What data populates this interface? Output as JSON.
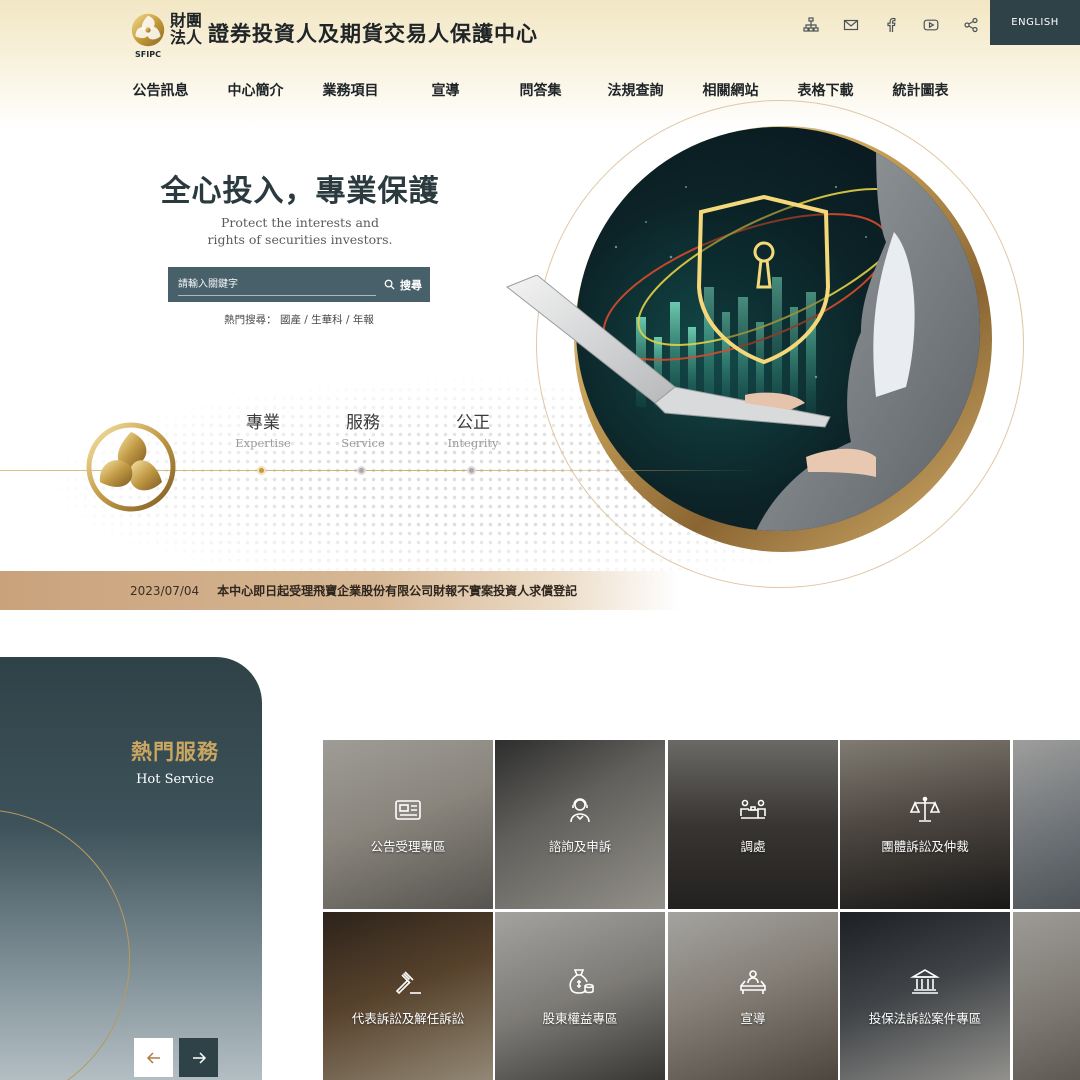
{
  "header": {
    "org_prefix": [
      "財團",
      "法人"
    ],
    "org_name": "證券投資人及期貨交易人保護中心",
    "org_abbr": "SFIPC",
    "utility_icons": [
      "sitemap-icon",
      "mail-icon",
      "facebook-icon",
      "youtube-icon",
      "share-icon"
    ],
    "language_button": "ENGLISH"
  },
  "nav": {
    "items": [
      "公告訊息",
      "中心簡介",
      "業務項目",
      "宣導",
      "問答集",
      "法規查詢",
      "相關網站",
      "表格下載",
      "統計圖表"
    ]
  },
  "hero": {
    "title": "全心投入，專業保護",
    "subtitle_lines": [
      "Protect the interests and",
      "rights of securities investors."
    ],
    "search": {
      "placeholder": "請輸入關鍵字",
      "button_label": "搜尋"
    },
    "hot_search": {
      "label": "熱門搜尋：",
      "keywords": [
        "國產",
        "生華科",
        "年報"
      ],
      "separator": " / "
    }
  },
  "values": [
    {
      "zh": "專業",
      "en": "Expertise",
      "active": true
    },
    {
      "zh": "服務",
      "en": "Service",
      "active": false
    },
    {
      "zh": "公正",
      "en": "Integrity",
      "active": false
    }
  ],
  "news": {
    "date": "2023/07/04",
    "text": "本中心即日起受理飛寶企業股份有限公司財報不實案投資人求償登記"
  },
  "hot_service": {
    "title": "熱門服務",
    "subtitle": "Hot Service",
    "tiles": [
      {
        "label": "公告受理專區",
        "icon": "announcement-board-icon"
      },
      {
        "label": "諮詢及申訴",
        "icon": "customer-service-icon"
      },
      {
        "label": "調處",
        "icon": "mediation-table-icon"
      },
      {
        "label": "團體訴訟及仲裁",
        "icon": "scales-icon"
      },
      {
        "label": "",
        "icon": ""
      },
      {
        "label": "代表訴訟及解任訴訟",
        "icon": "gavel-icon"
      },
      {
        "label": "股東權益專區",
        "icon": "money-bag-icon"
      },
      {
        "label": "宣導",
        "icon": "lecture-icon"
      },
      {
        "label": "投保法訴訟案件專區",
        "icon": "courthouse-icon"
      },
      {
        "label": "",
        "icon": ""
      }
    ]
  },
  "colors": {
    "primary_dark": "#2f4248",
    "search_bg": "#47606a",
    "gold": "#c9a661",
    "ticker_bg": "#c9a27b"
  }
}
